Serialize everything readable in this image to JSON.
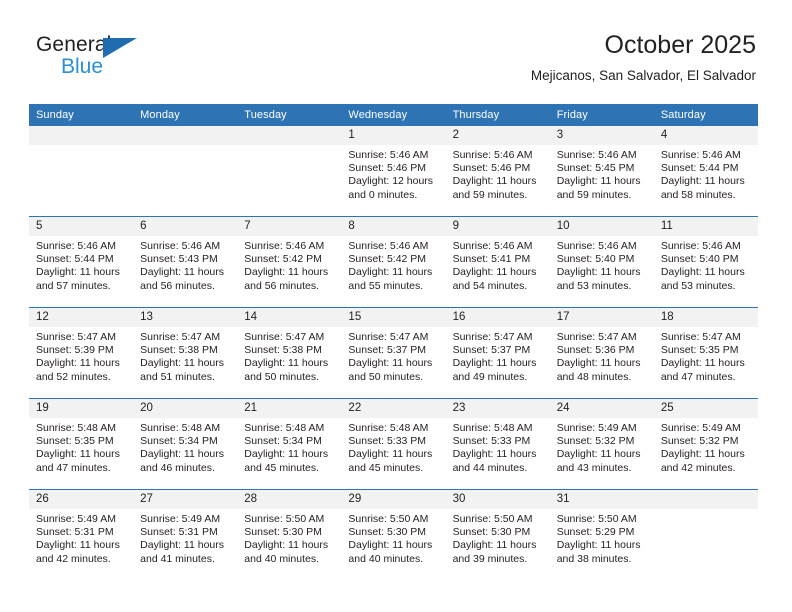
{
  "brand": {
    "name_part1": "General",
    "name_part2": "Blue",
    "accent_color": "#2e74b5",
    "logo_blue": "#2a8fd4"
  },
  "header": {
    "title": "October 2025",
    "subtitle": "Mejicanos, San Salvador, El Salvador"
  },
  "weekday_headers": [
    "Sunday",
    "Monday",
    "Tuesday",
    "Wednesday",
    "Thursday",
    "Friday",
    "Saturday"
  ],
  "weeks": [
    [
      {
        "day": "",
        "sunrise": "",
        "sunset": "",
        "daylight1": "",
        "daylight2": "",
        "empty": true
      },
      {
        "day": "",
        "sunrise": "",
        "sunset": "",
        "daylight1": "",
        "daylight2": "",
        "empty": true
      },
      {
        "day": "",
        "sunrise": "",
        "sunset": "",
        "daylight1": "",
        "daylight2": "",
        "empty": true
      },
      {
        "day": "1",
        "sunrise": "Sunrise: 5:46 AM",
        "sunset": "Sunset: 5:46 PM",
        "daylight1": "Daylight: 12 hours",
        "daylight2": "and 0 minutes."
      },
      {
        "day": "2",
        "sunrise": "Sunrise: 5:46 AM",
        "sunset": "Sunset: 5:46 PM",
        "daylight1": "Daylight: 11 hours",
        "daylight2": "and 59 minutes."
      },
      {
        "day": "3",
        "sunrise": "Sunrise: 5:46 AM",
        "sunset": "Sunset: 5:45 PM",
        "daylight1": "Daylight: 11 hours",
        "daylight2": "and 59 minutes."
      },
      {
        "day": "4",
        "sunrise": "Sunrise: 5:46 AM",
        "sunset": "Sunset: 5:44 PM",
        "daylight1": "Daylight: 11 hours",
        "daylight2": "and 58 minutes."
      }
    ],
    [
      {
        "day": "5",
        "sunrise": "Sunrise: 5:46 AM",
        "sunset": "Sunset: 5:44 PM",
        "daylight1": "Daylight: 11 hours",
        "daylight2": "and 57 minutes."
      },
      {
        "day": "6",
        "sunrise": "Sunrise: 5:46 AM",
        "sunset": "Sunset: 5:43 PM",
        "daylight1": "Daylight: 11 hours",
        "daylight2": "and 56 minutes."
      },
      {
        "day": "7",
        "sunrise": "Sunrise: 5:46 AM",
        "sunset": "Sunset: 5:42 PM",
        "daylight1": "Daylight: 11 hours",
        "daylight2": "and 56 minutes."
      },
      {
        "day": "8",
        "sunrise": "Sunrise: 5:46 AM",
        "sunset": "Sunset: 5:42 PM",
        "daylight1": "Daylight: 11 hours",
        "daylight2": "and 55 minutes."
      },
      {
        "day": "9",
        "sunrise": "Sunrise: 5:46 AM",
        "sunset": "Sunset: 5:41 PM",
        "daylight1": "Daylight: 11 hours",
        "daylight2": "and 54 minutes."
      },
      {
        "day": "10",
        "sunrise": "Sunrise: 5:46 AM",
        "sunset": "Sunset: 5:40 PM",
        "daylight1": "Daylight: 11 hours",
        "daylight2": "and 53 minutes."
      },
      {
        "day": "11",
        "sunrise": "Sunrise: 5:46 AM",
        "sunset": "Sunset: 5:40 PM",
        "daylight1": "Daylight: 11 hours",
        "daylight2": "and 53 minutes."
      }
    ],
    [
      {
        "day": "12",
        "sunrise": "Sunrise: 5:47 AM",
        "sunset": "Sunset: 5:39 PM",
        "daylight1": "Daylight: 11 hours",
        "daylight2": "and 52 minutes."
      },
      {
        "day": "13",
        "sunrise": "Sunrise: 5:47 AM",
        "sunset": "Sunset: 5:38 PM",
        "daylight1": "Daylight: 11 hours",
        "daylight2": "and 51 minutes."
      },
      {
        "day": "14",
        "sunrise": "Sunrise: 5:47 AM",
        "sunset": "Sunset: 5:38 PM",
        "daylight1": "Daylight: 11 hours",
        "daylight2": "and 50 minutes."
      },
      {
        "day": "15",
        "sunrise": "Sunrise: 5:47 AM",
        "sunset": "Sunset: 5:37 PM",
        "daylight1": "Daylight: 11 hours",
        "daylight2": "and 50 minutes."
      },
      {
        "day": "16",
        "sunrise": "Sunrise: 5:47 AM",
        "sunset": "Sunset: 5:37 PM",
        "daylight1": "Daylight: 11 hours",
        "daylight2": "and 49 minutes."
      },
      {
        "day": "17",
        "sunrise": "Sunrise: 5:47 AM",
        "sunset": "Sunset: 5:36 PM",
        "daylight1": "Daylight: 11 hours",
        "daylight2": "and 48 minutes."
      },
      {
        "day": "18",
        "sunrise": "Sunrise: 5:47 AM",
        "sunset": "Sunset: 5:35 PM",
        "daylight1": "Daylight: 11 hours",
        "daylight2": "and 47 minutes."
      }
    ],
    [
      {
        "day": "19",
        "sunrise": "Sunrise: 5:48 AM",
        "sunset": "Sunset: 5:35 PM",
        "daylight1": "Daylight: 11 hours",
        "daylight2": "and 47 minutes."
      },
      {
        "day": "20",
        "sunrise": "Sunrise: 5:48 AM",
        "sunset": "Sunset: 5:34 PM",
        "daylight1": "Daylight: 11 hours",
        "daylight2": "and 46 minutes."
      },
      {
        "day": "21",
        "sunrise": "Sunrise: 5:48 AM",
        "sunset": "Sunset: 5:34 PM",
        "daylight1": "Daylight: 11 hours",
        "daylight2": "and 45 minutes."
      },
      {
        "day": "22",
        "sunrise": "Sunrise: 5:48 AM",
        "sunset": "Sunset: 5:33 PM",
        "daylight1": "Daylight: 11 hours",
        "daylight2": "and 45 minutes."
      },
      {
        "day": "23",
        "sunrise": "Sunrise: 5:48 AM",
        "sunset": "Sunset: 5:33 PM",
        "daylight1": "Daylight: 11 hours",
        "daylight2": "and 44 minutes."
      },
      {
        "day": "24",
        "sunrise": "Sunrise: 5:49 AM",
        "sunset": "Sunset: 5:32 PM",
        "daylight1": "Daylight: 11 hours",
        "daylight2": "and 43 minutes."
      },
      {
        "day": "25",
        "sunrise": "Sunrise: 5:49 AM",
        "sunset": "Sunset: 5:32 PM",
        "daylight1": "Daylight: 11 hours",
        "daylight2": "and 42 minutes."
      }
    ],
    [
      {
        "day": "26",
        "sunrise": "Sunrise: 5:49 AM",
        "sunset": "Sunset: 5:31 PM",
        "daylight1": "Daylight: 11 hours",
        "daylight2": "and 42 minutes."
      },
      {
        "day": "27",
        "sunrise": "Sunrise: 5:49 AM",
        "sunset": "Sunset: 5:31 PM",
        "daylight1": "Daylight: 11 hours",
        "daylight2": "and 41 minutes."
      },
      {
        "day": "28",
        "sunrise": "Sunrise: 5:50 AM",
        "sunset": "Sunset: 5:30 PM",
        "daylight1": "Daylight: 11 hours",
        "daylight2": "and 40 minutes."
      },
      {
        "day": "29",
        "sunrise": "Sunrise: 5:50 AM",
        "sunset": "Sunset: 5:30 PM",
        "daylight1": "Daylight: 11 hours",
        "daylight2": "and 40 minutes."
      },
      {
        "day": "30",
        "sunrise": "Sunrise: 5:50 AM",
        "sunset": "Sunset: 5:30 PM",
        "daylight1": "Daylight: 11 hours",
        "daylight2": "and 39 minutes."
      },
      {
        "day": "31",
        "sunrise": "Sunrise: 5:50 AM",
        "sunset": "Sunset: 5:29 PM",
        "daylight1": "Daylight: 11 hours",
        "daylight2": "and 38 minutes."
      },
      {
        "day": "",
        "sunrise": "",
        "sunset": "",
        "daylight1": "",
        "daylight2": "",
        "empty": true
      }
    ]
  ]
}
